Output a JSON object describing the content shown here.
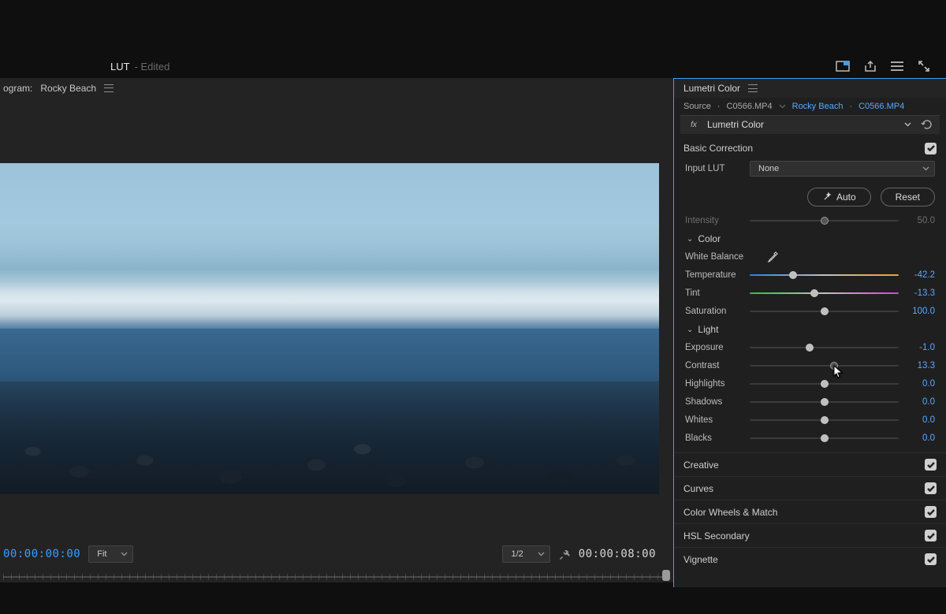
{
  "tab": {
    "name": "LUT",
    "suffix": "- Edited"
  },
  "top_icons": {
    "window": "window-maximize-icon",
    "share": "share-icon",
    "menu": "menu-icon",
    "fullscreen": "fullscreen-icon"
  },
  "program": {
    "prefix": "ogram:",
    "name": "Rocky Beach"
  },
  "transport": {
    "tc_in": "00:00:00:00",
    "tc_out": "00:00:08:00",
    "fit_label": "Fit",
    "zoom_label": "1/2"
  },
  "lumetri": {
    "title": "Lumetri Color",
    "source_label": "Source",
    "source_file": "C0566.MP4",
    "clip_name": "Rocky Beach",
    "clip_file": "C0566.MP4",
    "fx_label": "fx",
    "effect_name": "Lumetri Color",
    "basic": {
      "title": "Basic Correction",
      "input_lut_label": "Input LUT",
      "input_lut_value": "None",
      "auto": "Auto",
      "reset": "Reset",
      "intensity": {
        "label": "Intensity",
        "value": "50.0",
        "pos": 50
      },
      "color": {
        "title": "Color",
        "wb_label": "White Balance",
        "temperature": {
          "label": "Temperature",
          "value": "-42.2",
          "pos": 28.9
        },
        "tint": {
          "label": "Tint",
          "value": "-13.3",
          "pos": 43.35
        },
        "saturation": {
          "label": "Saturation",
          "value": "100.0",
          "pos": 50
        }
      },
      "light": {
        "title": "Light",
        "exposure": {
          "label": "Exposure",
          "value": "-1.0",
          "pos": 40
        },
        "contrast": {
          "label": "Contrast",
          "value": "13.3",
          "pos": 56.65
        },
        "highlights": {
          "label": "Highlights",
          "value": "0.0",
          "pos": 50
        },
        "shadows": {
          "label": "Shadows",
          "value": "0.0",
          "pos": 50
        },
        "whites": {
          "label": "Whites",
          "value": "0.0",
          "pos": 50
        },
        "blacks": {
          "label": "Blacks",
          "value": "0.0",
          "pos": 50
        }
      }
    },
    "sections": {
      "creative": "Creative",
      "curves": "Curves",
      "wheels": "Color Wheels & Match",
      "hsl": "HSL Secondary",
      "vignette": "Vignette"
    }
  }
}
